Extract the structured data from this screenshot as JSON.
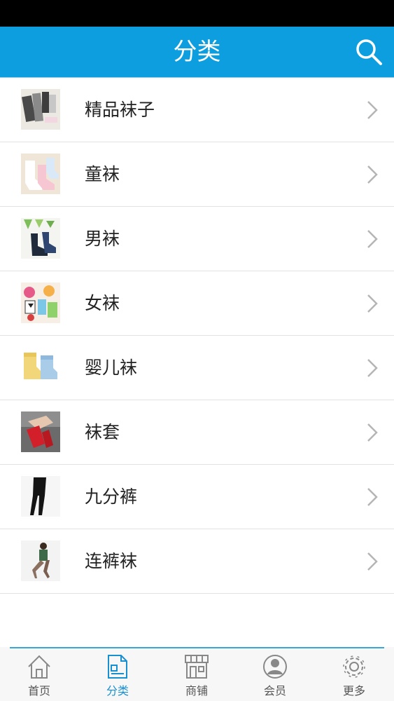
{
  "header": {
    "title": "分类",
    "background": "#0d9ee0"
  },
  "categories": [
    {
      "label": "精品袜子",
      "thumb_icon": "socks-product-photo"
    },
    {
      "label": "童袜",
      "thumb_icon": "kids-socks-photo"
    },
    {
      "label": "男袜",
      "thumb_icon": "mens-socks-photo"
    },
    {
      "label": "女袜",
      "thumb_icon": "womens-socks-photo"
    },
    {
      "label": "婴儿袜",
      "thumb_icon": "baby-socks-photo"
    },
    {
      "label": "袜套",
      "thumb_icon": "leg-warmers-photo"
    },
    {
      "label": "九分裤",
      "thumb_icon": "leggings-photo"
    },
    {
      "label": "连裤袜",
      "thumb_icon": "pantyhose-photo"
    }
  ],
  "tabs": [
    {
      "label": "首页",
      "icon": "home-icon",
      "active": false
    },
    {
      "label": "分类",
      "icon": "category-icon",
      "active": true
    },
    {
      "label": "商铺",
      "icon": "store-icon",
      "active": false
    },
    {
      "label": "会员",
      "icon": "member-icon",
      "active": false
    },
    {
      "label": "更多",
      "icon": "gear-icon",
      "active": false
    }
  ],
  "colors": {
    "accent": "#1a8fd0",
    "tab_text": "#555555"
  }
}
